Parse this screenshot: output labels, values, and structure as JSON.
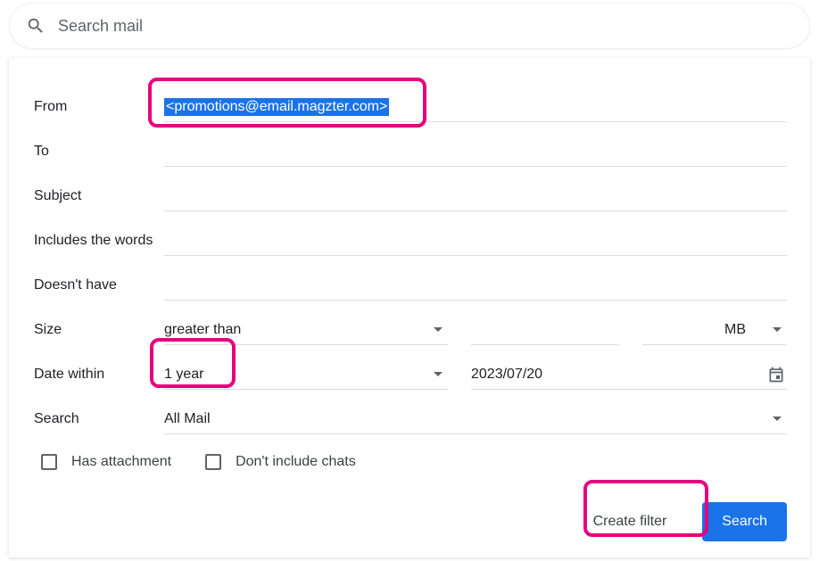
{
  "search": {
    "placeholder": "Search mail"
  },
  "labels": {
    "from": "From",
    "to": "To",
    "subject": "Subject",
    "includes": "Includes the words",
    "doesnt": "Doesn't have",
    "size": "Size",
    "date_within": "Date within",
    "search": "Search"
  },
  "values": {
    "from": "<promotions@email.magzter.com>",
    "size_op": "greater than",
    "size_unit": "MB",
    "date_range": "1 year",
    "date": "2023/07/20",
    "search_scope": "All Mail"
  },
  "checks": {
    "has_attachment": "Has attachment",
    "no_chats": "Don't include chats"
  },
  "buttons": {
    "create_filter": "Create filter",
    "search": "Search"
  }
}
